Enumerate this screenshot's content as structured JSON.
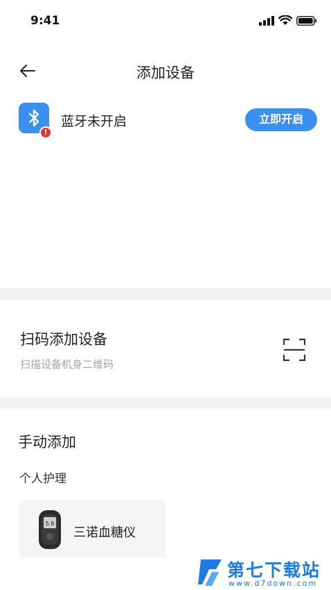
{
  "status_bar": {
    "time": "9:41",
    "icons": [
      "signal-icon",
      "wifi-icon",
      "battery-icon"
    ]
  },
  "nav": {
    "title": "添加设备",
    "back_icon": "back-arrow-icon"
  },
  "bluetooth": {
    "status_text": "蓝牙未开启",
    "open_button_label": "立即开启",
    "icon": "bluetooth-icon",
    "warning_icon": "warning-badge-icon",
    "warning_mark": "!"
  },
  "scan": {
    "title": "扫码添加设备",
    "subtitle": "扫描设备机身二维码",
    "icon": "scan-icon"
  },
  "manual": {
    "title": "手动添加",
    "category": "个人护理",
    "devices": [
      {
        "name": "三诺血糖仪",
        "icon": "glucose-meter-icon"
      }
    ]
  },
  "watermark": {
    "name": "第七下载站",
    "url": "www.d7down.com"
  },
  "colors": {
    "accent": "#3a8ff0",
    "warning": "#e8312a",
    "divider": "#f3f3f3",
    "card_bg": "#f5f5f5",
    "subtext": "#a6a6a6"
  }
}
